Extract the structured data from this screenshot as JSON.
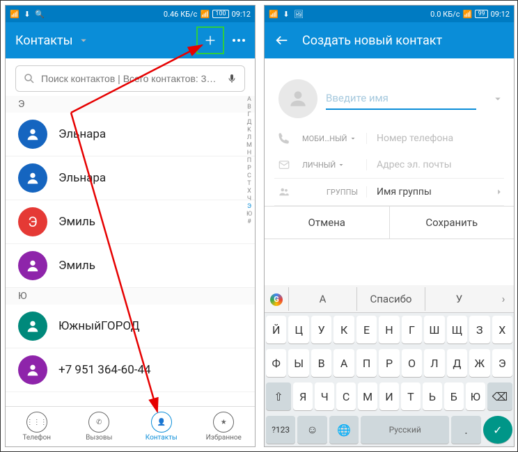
{
  "status": {
    "speed_left": "0.46 КБ/с",
    "speed_right": "0.0 КБ/с",
    "battery_left": "100",
    "battery_right": "99",
    "time": "09:12"
  },
  "left": {
    "title": "Контакты",
    "search_placeholder": "Поиск контактов | Всего контактов: 3…",
    "sections": [
      {
        "letter": "Э",
        "contacts": [
          {
            "name": "Эльнара",
            "color": "#1565c0"
          },
          {
            "name": "Эльнара",
            "color": "#1565c0"
          },
          {
            "name": "Эмиль",
            "color": "#e53935",
            "initial": "Э"
          },
          {
            "name": "Эмиль",
            "color": "#8e24aa"
          }
        ]
      },
      {
        "letter": "Ю",
        "contacts": [
          {
            "name": "ЮжныйГОРОД",
            "color": "#00897b"
          },
          {
            "name": "+7 951 364-60-44",
            "color": "#8e24aa"
          }
        ]
      }
    ],
    "alpha": [
      "A",
      "B",
      "Г",
      "Д",
      "K",
      "Л",
      "M",
      "Н",
      "П",
      "Р",
      "С",
      "Т",
      "Х",
      "Ч",
      "Э",
      "Ю",
      "#"
    ],
    "alpha_active": "Э",
    "nav": [
      {
        "label": "Телефон",
        "icon": "dialpad"
      },
      {
        "label": "Вызовы",
        "icon": "phone"
      },
      {
        "label": "Контакты",
        "icon": "person",
        "active": true
      },
      {
        "label": "Избранное",
        "icon": "star"
      }
    ]
  },
  "right": {
    "title": "Создать новый контакт",
    "name_placeholder": "Введите имя",
    "phone_type": "МОБИ…НЫЙ",
    "phone_placeholder": "Номер телефона",
    "email_type": "ЛИЧНЫЙ",
    "email_placeholder": "Адрес эл. почты",
    "groups_label": "ГРУППЫ",
    "groups_value": "Имя группы",
    "cancel": "Отмена",
    "save": "Сохранить",
    "suggestions": [
      "А",
      "Спасибо",
      "У"
    ],
    "keys_r1": [
      "Й",
      "Ц",
      "У",
      "К",
      "Е",
      "Н",
      "Г",
      "Ш",
      "Щ",
      "З",
      "Х"
    ],
    "keys_r2": [
      "Ф",
      "Ы",
      "В",
      "А",
      "П",
      "Р",
      "О",
      "Л",
      "Д",
      "Ж",
      "Э"
    ],
    "keys_r3": [
      "⇧",
      "Я",
      "Ч",
      "С",
      "М",
      "И",
      "Т",
      "Ь",
      "Б",
      "Ю",
      "⌫"
    ],
    "keys_r4_left": "?123",
    "keys_r4_space": "Русский"
  }
}
